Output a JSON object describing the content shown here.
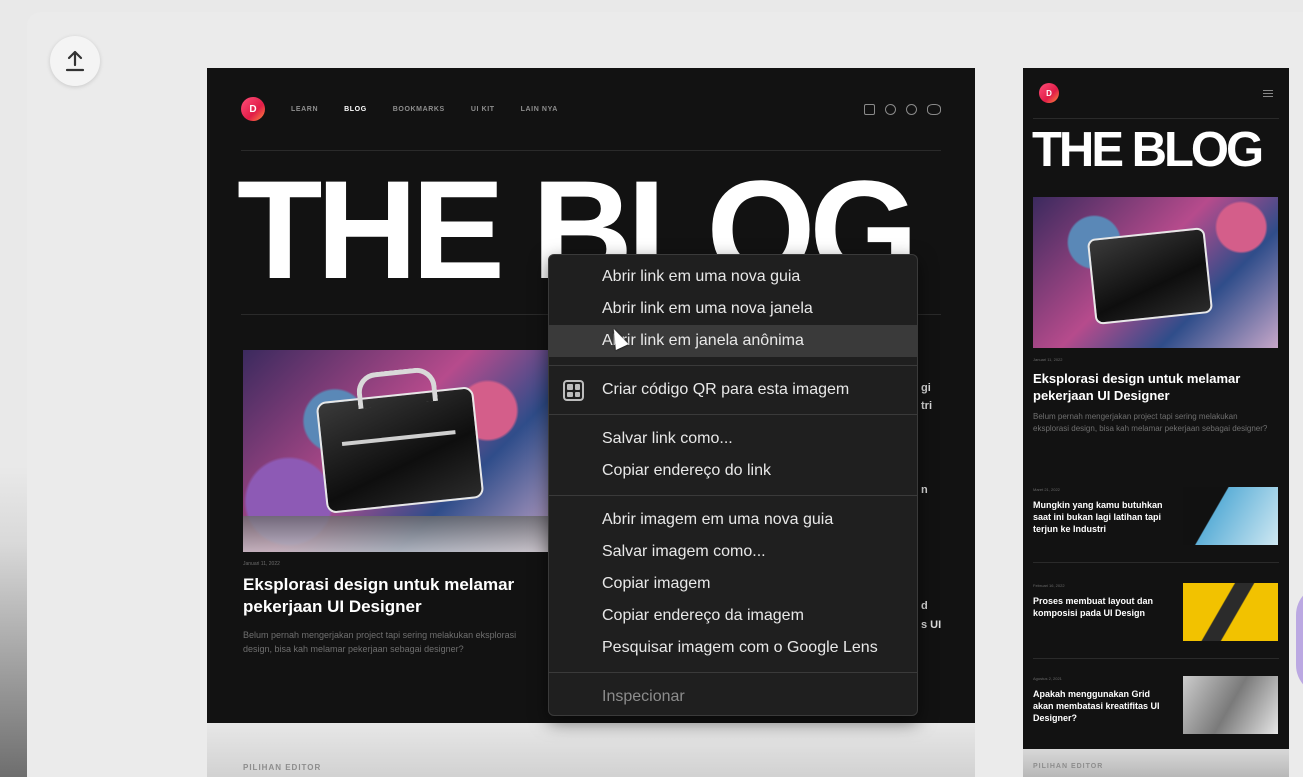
{
  "desktop": {
    "logo_letter": "D",
    "nav": [
      "LEARN",
      "BLOG",
      "BOOKMARKS",
      "UI KIT",
      "LAIN NYA"
    ],
    "title": "THE BLOG",
    "featured": {
      "date": "Januari 11, 2022",
      "title": "Eksplorasi design untuk melamar pekerjaan UI Designer",
      "excerpt": "Belum pernah mengerjakan project tapi sering melakukan eksplorasi design, bisa kah melamar pekerjaan sebagai designer?"
    },
    "side_fragments": [
      "gi",
      "tri",
      "n",
      "d",
      "s UI"
    ],
    "below_label": "PILIHAN EDITOR"
  },
  "mobile": {
    "logo_letter": "D",
    "title": "THE BLOG",
    "featured": {
      "date": "Januari 11, 2022",
      "title": "Eksplorasi design untuk melamar pekerjaan UI Designer",
      "excerpt": "Belum pernah mengerjakan project tapi sering melakukan eksplorasi design, bisa kah melamar pekerjaan sebagai designer?"
    },
    "items": [
      {
        "date": "Maret 21, 2022",
        "title": "Mungkin yang kamu butuhkan saat ini bukan lagi latihan tapi terjun ke Industri"
      },
      {
        "date": "Februari 16, 2022",
        "title": "Proses membuat layout dan komposisi pada UI Design"
      },
      {
        "date": "Agustus 2, 2021",
        "title": "Apakah menggunakan Grid akan membatasi kreatifitas UI Designer?"
      }
    ],
    "below_label": "PILIHAN EDITOR"
  },
  "context_menu": {
    "open_new_tab": "Abrir link em uma nova guia",
    "open_new_window": "Abrir link em uma nova janela",
    "open_incognito": "Abrir link em janela anônima",
    "create_qr": "Criar código QR para esta imagem",
    "save_link": "Salvar link como...",
    "copy_link": "Copiar endereço do link",
    "open_image_tab": "Abrir imagem em uma nova guia",
    "save_image": "Salvar imagem como...",
    "copy_image": "Copiar imagem",
    "copy_image_address": "Copiar endereço da imagem",
    "google_lens": "Pesquisar imagem com o Google Lens",
    "inspect": "Inspecionar"
  }
}
